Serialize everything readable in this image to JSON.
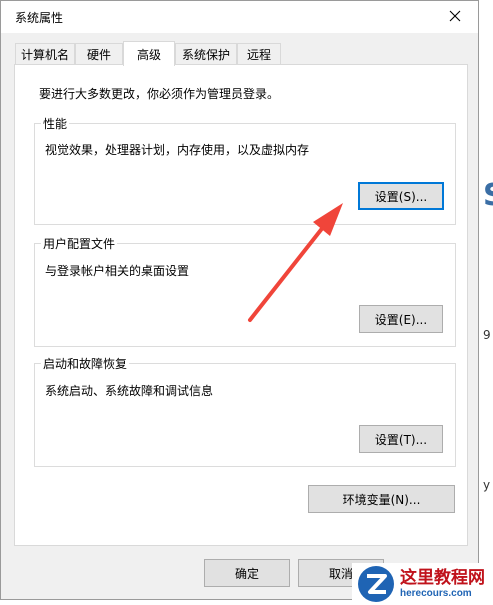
{
  "window": {
    "title": "系统属性"
  },
  "tabs": [
    {
      "label": "计算机名",
      "active": false
    },
    {
      "label": "硬件",
      "active": false
    },
    {
      "label": "高级",
      "active": true
    },
    {
      "label": "系统保护",
      "active": false
    },
    {
      "label": "远程",
      "active": false
    }
  ],
  "notice": "要进行大多数更改，你必须作为管理员登录。",
  "groups": {
    "performance": {
      "title": "性能",
      "description": "视觉效果，处理器计划，内存使用，以及虚拟内存",
      "button": "设置(S)..."
    },
    "user_profiles": {
      "title": "用户配置文件",
      "description": "与登录帐户相关的桌面设置",
      "button": "设置(E)..."
    },
    "startup_recovery": {
      "title": "启动和故障恢复",
      "description": "系统启动、系统故障和调试信息",
      "button": "设置(T)..."
    }
  },
  "env_button": "环境变量(N)...",
  "footer": {
    "ok": "确定",
    "cancel": "取消"
  },
  "watermark": {
    "main": "这里教程网",
    "sub": "herecours.com"
  },
  "side_glyphs": [
    "S",
    "9",
    "y"
  ],
  "colors": {
    "accent": "#0078d7",
    "arrow": "#f0453a",
    "watermark_red": "#c0121b",
    "watermark_blue": "#1f64b4"
  }
}
